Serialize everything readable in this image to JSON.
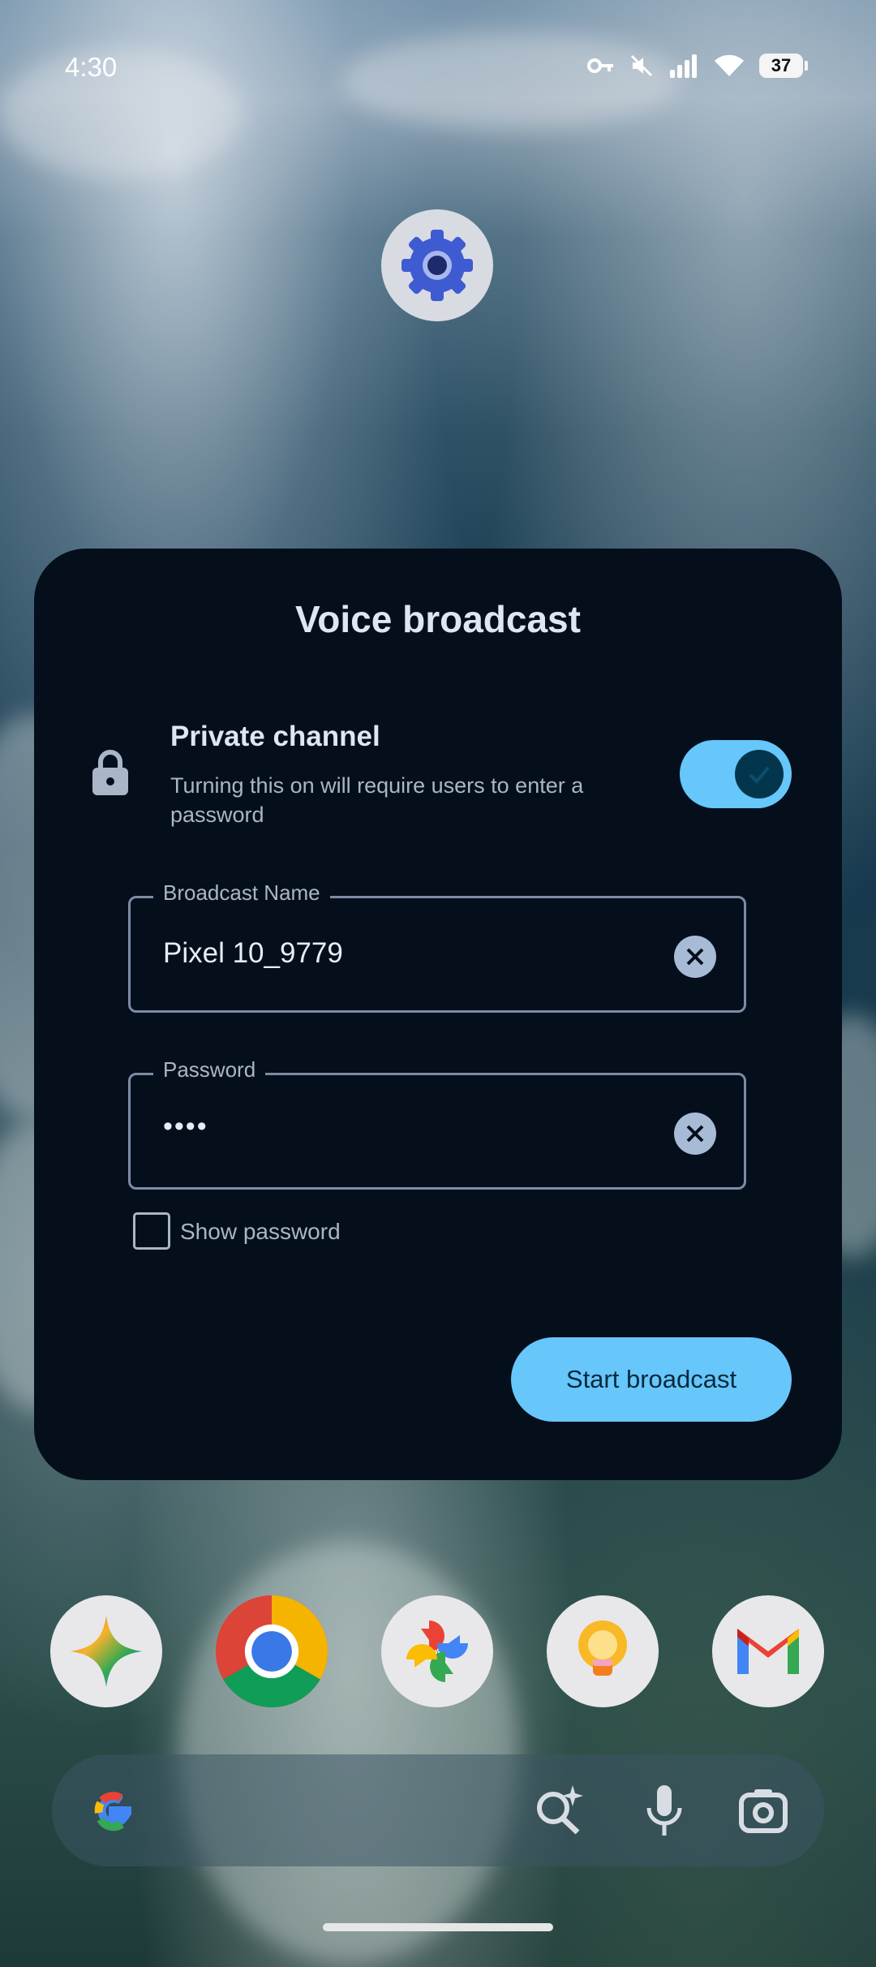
{
  "status_bar": {
    "time": "4:30",
    "battery": "37",
    "icons": [
      "vpn-key-icon",
      "mute-icon",
      "signal-icon",
      "wifi-icon",
      "battery-icon"
    ]
  },
  "home": {
    "settings_app_icon": "settings-gear-icon",
    "dock_apps": [
      "gemini-icon",
      "chrome-icon",
      "photos-icon",
      "keep-bulb-icon",
      "gmail-icon"
    ],
    "search_bar_icons": [
      "google-g-icon",
      "ai-search-icon",
      "mic-icon",
      "lens-camera-icon"
    ]
  },
  "dialog": {
    "title": "Voice broadcast",
    "private_channel": {
      "title": "Private channel",
      "description": "Turning this on will require users to enter a password",
      "enabled": true
    },
    "broadcast_name": {
      "label": "Broadcast Name",
      "value": "Pixel 10_9779"
    },
    "password": {
      "label": "Password",
      "value": "••••"
    },
    "show_password": {
      "label": "Show password",
      "checked": false
    },
    "start_button": "Start broadcast"
  },
  "colors": {
    "dialog_bg": "#050f1c",
    "accent": "#67c6fa",
    "title": "#dce6f4"
  }
}
